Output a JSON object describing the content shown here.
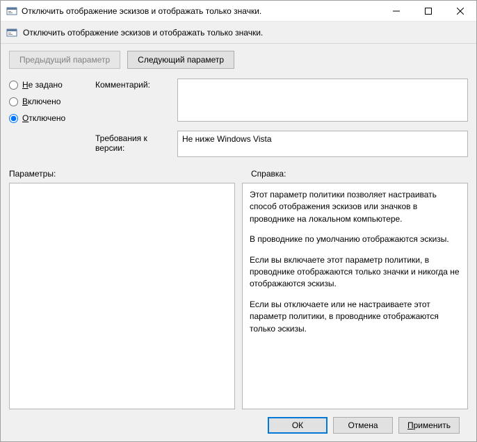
{
  "window": {
    "title": "Отключить отображение эскизов и отображать только значки."
  },
  "subheader": {
    "text": "Отключить отображение эскизов и отображать только значки."
  },
  "nav": {
    "prev": "Предыдущий параметр",
    "next": "Следующий параметр"
  },
  "radios": {
    "not_configured_prefix": "Н",
    "not_configured_rest": "е задано",
    "enabled_prefix": "В",
    "enabled_rest": "ключено",
    "disabled_prefix": "О",
    "disabled_rest": "тключено"
  },
  "labels": {
    "comment": "Комментарий:",
    "requirements": "Требования к версии:",
    "parameters": "Параметры:",
    "help": "Справка:"
  },
  "fields": {
    "comment_value": "",
    "requirements_value": "Не ниже Windows Vista"
  },
  "help": {
    "p1": "Этот параметр политики позволяет настраивать способ отображения эскизов или значков в проводнике на локальном компьютере.",
    "p2": "В проводнике по умолчанию отображаются эскизы.",
    "p3": "Если вы включаете этот параметр политики, в проводнике отображаются только значки и никогда не отображаются эскизы.",
    "p4": "Если вы отключаете или не настраиваете этот параметр политики, в проводнике отображаются только эскизы."
  },
  "footer": {
    "ok": "ОК",
    "cancel": "Отмена",
    "apply_prefix": "П",
    "apply_rest": "рименить"
  }
}
